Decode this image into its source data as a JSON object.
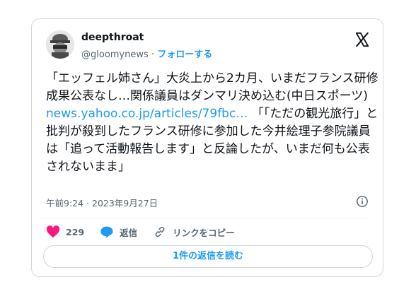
{
  "user": {
    "display_name": "deepthroat",
    "handle": "@gloomynews",
    "separator": " · ",
    "follow_label": "フォローする"
  },
  "tweet": {
    "text_before_link": "「エッフェル姉さん」大炎上から2カ月、いまだフランス研修成果公表なし…関係議員はダンマリ決め込む(中日スポーツ)\n",
    "link_text": "news.yahoo.co.jp/articles/79fbc…",
    "text_after_link": " 「「ただの観光旅行」と批判が殺到したフランス研修に参加した今井絵理子参院議員は「追って活動報告します」と反論したが、いまだ何も公表されないまま」",
    "timestamp": "午前9:24 · 2023年9月27日"
  },
  "actions": {
    "like_count": "229",
    "reply_label": "返信",
    "copy_link_label": "リンクをコピー"
  },
  "read_replies_label": "1件の返信を読む",
  "colors": {
    "accent": "#1d9bf0",
    "like": "#f91880",
    "text": "#0f1419",
    "muted": "#536471"
  },
  "icons": [
    "x-logo-icon",
    "info-icon",
    "heart-icon",
    "reply-icon",
    "link-icon"
  ]
}
